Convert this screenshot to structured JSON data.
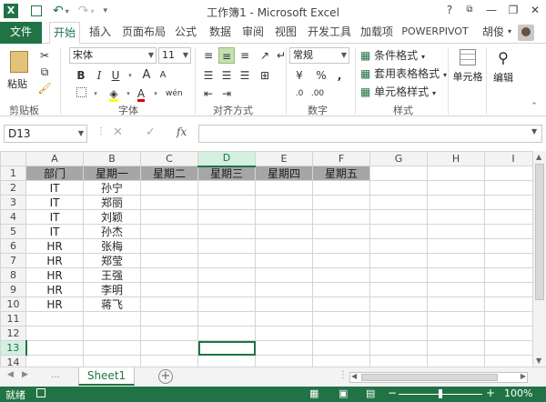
{
  "window": {
    "title": "工作簿1 - Microsoft Excel"
  },
  "quick_access": {
    "icons": [
      "excel-logo-icon",
      "save-icon",
      "undo-icon",
      "redo-icon",
      "customize-icon"
    ]
  },
  "window_controls": {
    "help": "?",
    "minimize": "—",
    "restore": "❐",
    "close": "✕"
  },
  "tabs": {
    "file": "文件",
    "items": [
      "开始",
      "插入",
      "页面布局",
      "公式",
      "数据",
      "审阅",
      "视图",
      "开发工具",
      "加载项",
      "POWERPIVOT"
    ],
    "user": "胡俊"
  },
  "ribbon": {
    "clipboard": {
      "paste": "粘贴",
      "label": "剪贴板"
    },
    "font": {
      "name": "宋体",
      "size": "11",
      "bold": "B",
      "italic": "I",
      "underline": "U",
      "grow": "A",
      "shrink": "A",
      "label": "字体",
      "wen": "wén"
    },
    "alignment": {
      "label": "对齐方式"
    },
    "number": {
      "format": "常规",
      "label": "数字",
      "currency": "¥",
      "percent": "%",
      "comma": ","
    },
    "styles": {
      "conditional": "条件格式",
      "table": "套用表格格式",
      "cell": "单元格样式",
      "label": "样式"
    },
    "cells": {
      "label": "单元格"
    },
    "editing": {
      "label": "编辑"
    }
  },
  "formula_bar": {
    "name_box": "D13",
    "fx": "fx",
    "value": ""
  },
  "columns": [
    "A",
    "B",
    "C",
    "D",
    "E",
    "F",
    "G",
    "H",
    "I"
  ],
  "rows": [
    [
      "部门",
      "星期一",
      "星期二",
      "星期三",
      "星期四",
      "星期五",
      "",
      "",
      ""
    ],
    [
      "IT",
      "孙宁",
      "",
      "",
      "",
      "",
      "",
      "",
      ""
    ],
    [
      "IT",
      "郑丽",
      "",
      "",
      "",
      "",
      "",
      "",
      ""
    ],
    [
      "IT",
      "刘颖",
      "",
      "",
      "",
      "",
      "",
      "",
      ""
    ],
    [
      "IT",
      "孙杰",
      "",
      "",
      "",
      "",
      "",
      "",
      ""
    ],
    [
      "HR",
      "张梅",
      "",
      "",
      "",
      "",
      "",
      "",
      ""
    ],
    [
      "HR",
      "郑莹",
      "",
      "",
      "",
      "",
      "",
      "",
      ""
    ],
    [
      "HR",
      "王强",
      "",
      "",
      "",
      "",
      "",
      "",
      ""
    ],
    [
      "HR",
      "李明",
      "",
      "",
      "",
      "",
      "",
      "",
      ""
    ],
    [
      "HR",
      "蒋飞",
      "",
      "",
      "",
      "",
      "",
      "",
      ""
    ],
    [
      "",
      "",
      "",
      "",
      "",
      "",
      "",
      "",
      ""
    ],
    [
      "",
      "",
      "",
      "",
      "",
      "",
      "",
      "",
      ""
    ],
    [
      "",
      "",
      "",
      "",
      "",
      "",
      "",
      "",
      ""
    ],
    [
      "",
      "",
      "",
      "",
      "",
      "",
      "",
      "",
      ""
    ]
  ],
  "selected_cell": {
    "col": "D",
    "row": 13
  },
  "sheets": [
    "Sheet1"
  ],
  "status": {
    "ready": "就绪",
    "zoom": "100%"
  },
  "colors": {
    "accent": "#217346",
    "header_fill": "#a6a6a6"
  }
}
